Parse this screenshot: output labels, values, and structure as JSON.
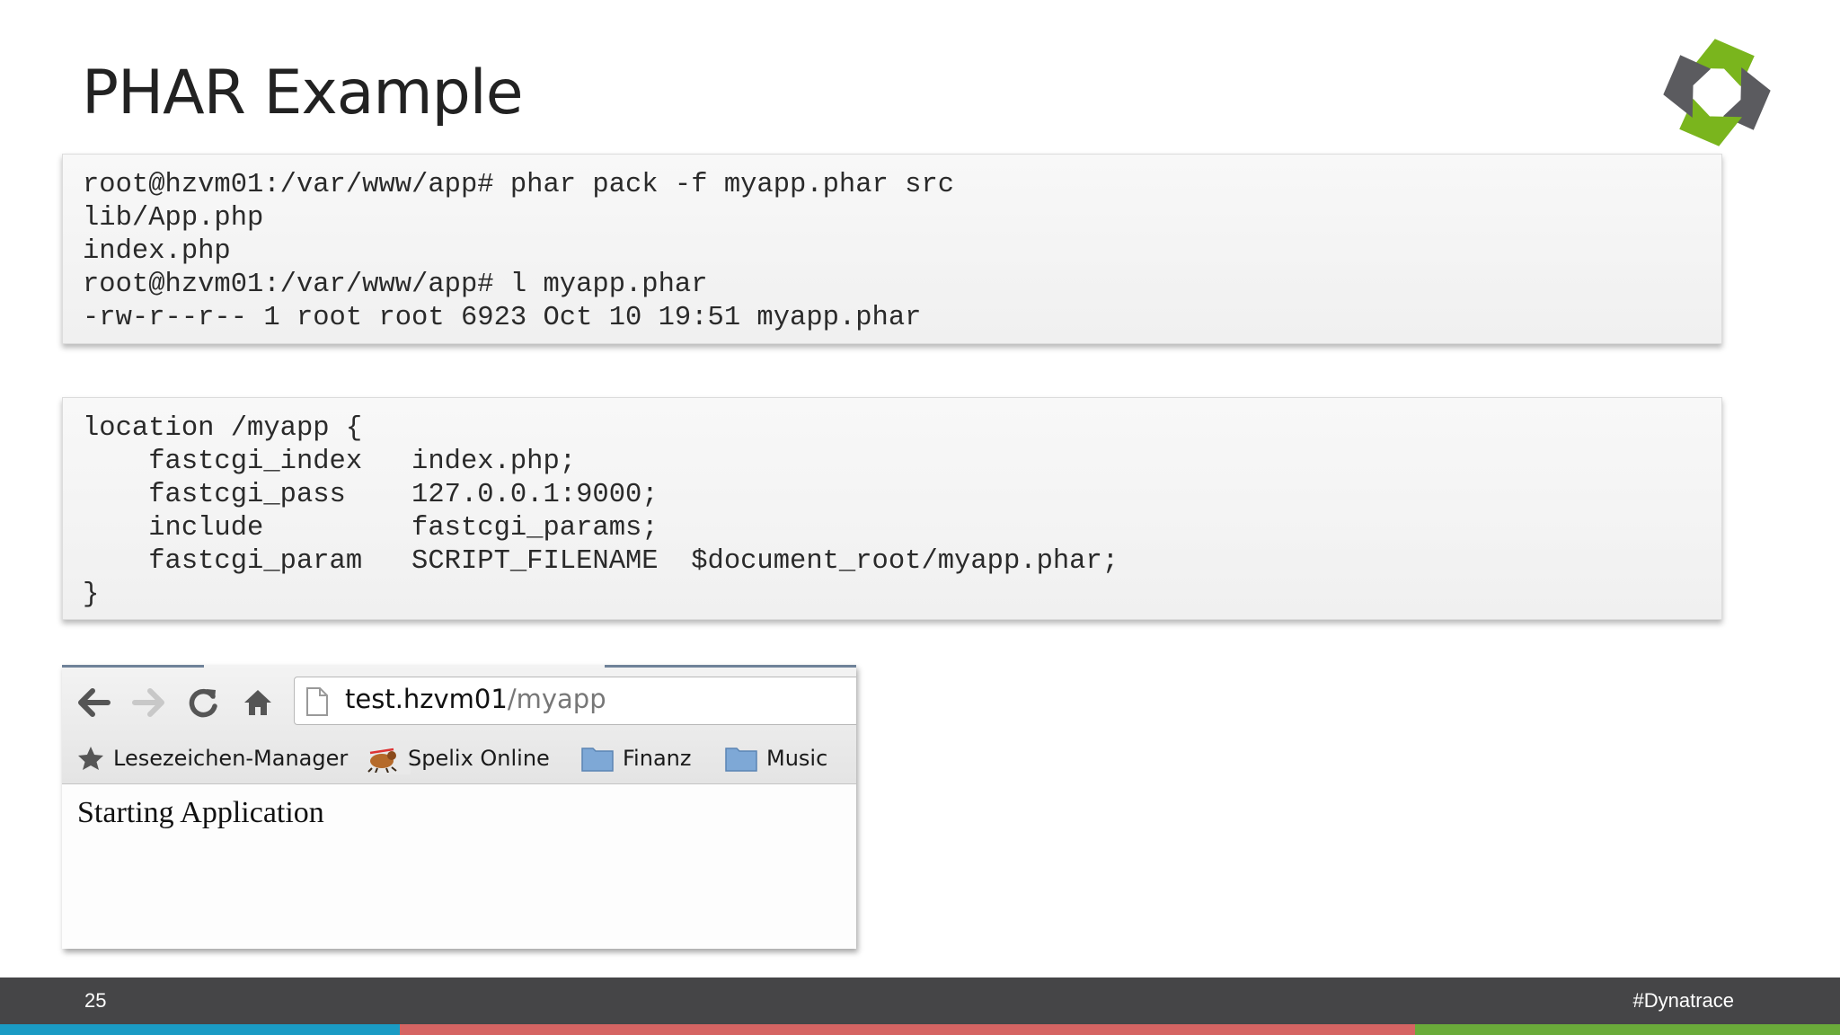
{
  "slide": {
    "title": "PHAR Example",
    "page_number": "25",
    "hashtag": "#Dynatrace",
    "logo": "dynatrace-logo",
    "colors": {
      "footer_bg": "#454547",
      "bar_blue": "#1a9bc4",
      "bar_red": "#d56463",
      "bar_green": "#6aab3a",
      "logo_green": "#7ab51d",
      "logo_gray": "#5b5b5f"
    }
  },
  "code_blocks": [
    {
      "lines": [
        "root@hzvm01:/var/www/app# phar pack -f myapp.phar src",
        "lib/App.php",
        "index.php",
        "root@hzvm01:/var/www/app# l myapp.phar",
        "-rw-r--r-- 1 root root 6923 Oct 10 19:51 myapp.phar"
      ]
    },
    {
      "lines": [
        "location /myapp {",
        "    fastcgi_index   index.php;",
        "    fastcgi_pass    127.0.0.1:9000;",
        "    include         fastcgi_params;",
        "    fastcgi_param   SCRIPT_FILENAME  $document_root/myapp.phar;",
        "}"
      ]
    }
  ],
  "browser": {
    "url_host": "test.hzvm01",
    "url_path": "/myapp",
    "nav_icons": [
      "back-arrow-icon",
      "forward-arrow-icon",
      "reload-icon",
      "home-icon"
    ],
    "bookmarks": [
      {
        "label": "Lesezeichen-Manager",
        "icon": "star-icon"
      },
      {
        "label": "Spelix Online",
        "icon": "spelix-icon"
      },
      {
        "label": "Finanz",
        "icon": "folder-icon"
      },
      {
        "label": "Music",
        "icon": "folder-icon"
      }
    ],
    "page_text": "Starting Application"
  }
}
